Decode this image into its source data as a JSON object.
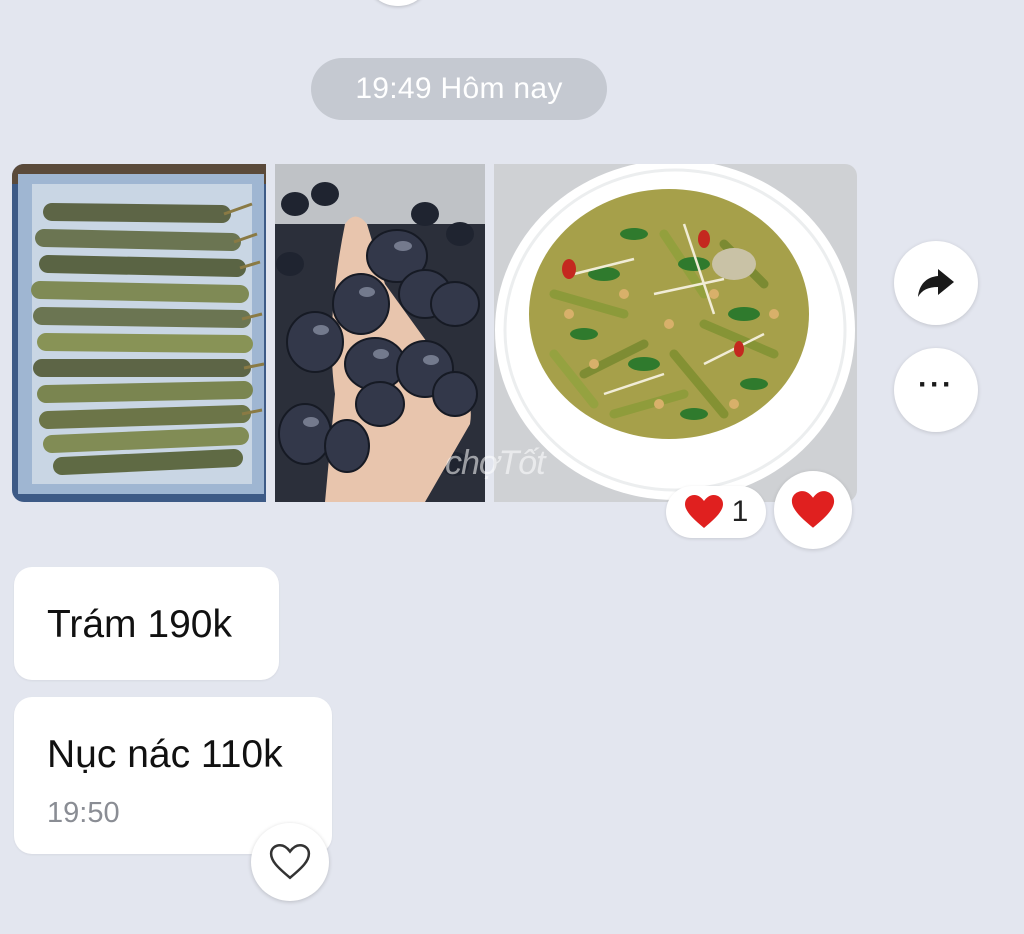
{
  "chat": {
    "date_pill": "19:49 Hôm nay",
    "reaction": {
      "icon": "heart-icon",
      "count": "1"
    },
    "messages": [
      {
        "text": "Trám 190k"
      },
      {
        "text": "Nục nác 110k",
        "time": "19:50"
      }
    ],
    "watermark": "chợTốt"
  },
  "icons": {
    "forward": "forward-arrow-icon",
    "more": "more-dots-icon",
    "heart_filled": "heart-filled-icon",
    "heart_outline": "heart-outline-icon"
  },
  "colors": {
    "background": "#e3e6ef",
    "pill": "#c5c9d1",
    "heart": "#e0201f"
  }
}
